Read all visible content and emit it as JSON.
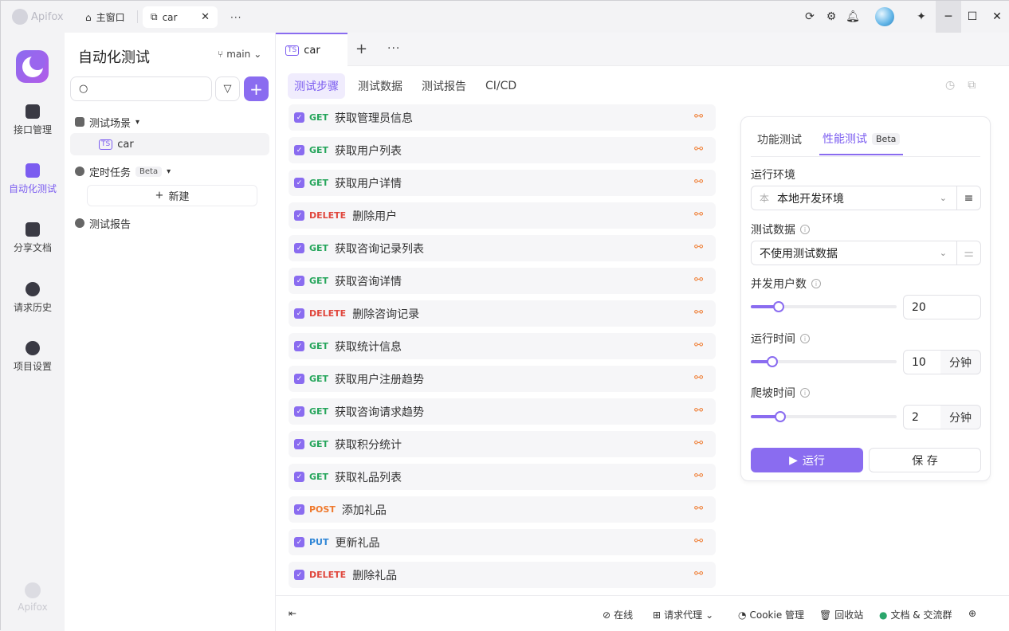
{
  "titlebar": {
    "logo_text": "Apifox",
    "home_tab": "主窗口",
    "doc_tab": "car",
    "more": "···"
  },
  "rail": {
    "items": [
      {
        "label": "接口管理",
        "icon": "api-icon"
      },
      {
        "label": "自动化测试",
        "icon": "automation-icon"
      },
      {
        "label": "分享文档",
        "icon": "book-icon"
      },
      {
        "label": "请求历史",
        "icon": "history-icon"
      },
      {
        "label": "项目设置",
        "icon": "settings-icon"
      }
    ],
    "bottom_text": "Apifox"
  },
  "sidebar": {
    "title": "自动化测试",
    "branch": "main",
    "search_placeholder": "",
    "tree": [
      {
        "label": "测试场景",
        "arrow": "▾"
      },
      {
        "label": "car"
      },
      {
        "label": "定时任务",
        "badge": "Beta",
        "arrow": "▾"
      },
      {
        "label": "测试报告"
      }
    ],
    "new_label": "新建"
  },
  "main": {
    "doc_tab": "car",
    "subtabs": [
      "测试步骤",
      "测试数据",
      "测试报告",
      "CI/CD"
    ],
    "steps": [
      {
        "method": "GET",
        "name": "获取管理员信息"
      },
      {
        "method": "GET",
        "name": "获取用户列表"
      },
      {
        "method": "GET",
        "name": "获取用户详情"
      },
      {
        "method": "DELETE",
        "name": "删除用户"
      },
      {
        "method": "GET",
        "name": "获取咨询记录列表"
      },
      {
        "method": "GET",
        "name": "获取咨询详情"
      },
      {
        "method": "DELETE",
        "name": "删除咨询记录"
      },
      {
        "method": "GET",
        "name": "获取统计信息"
      },
      {
        "method": "GET",
        "name": "获取用户注册趋势"
      },
      {
        "method": "GET",
        "name": "获取咨询请求趋势"
      },
      {
        "method": "GET",
        "name": "获取积分统计"
      },
      {
        "method": "GET",
        "name": "获取礼品列表"
      },
      {
        "method": "POST",
        "name": "添加礼品"
      },
      {
        "method": "PUT",
        "name": "更新礼品"
      },
      {
        "method": "DELETE",
        "name": "删除礼品"
      }
    ]
  },
  "panel": {
    "tabs": [
      "功能测试",
      "性能测试"
    ],
    "beta": "Beta",
    "env_label": "运行环境",
    "env_badge": "本",
    "env_value": "本地开发环境",
    "data_label": "测试数据",
    "data_value": "不使用测试数据",
    "users_label": "并发用户数",
    "users_value": "20",
    "users_fraction": 0.19,
    "time_label": "运行时间",
    "time_value": "10",
    "time_fraction": 0.15,
    "ramp_label": "爬坡时间",
    "ramp_value": "2",
    "ramp_fraction": 0.2,
    "unit": "分钟",
    "run_label": "运行",
    "save_label": "保 存"
  },
  "footer": {
    "online": "在线",
    "proxy": "请求代理",
    "cookie": "Cookie 管理",
    "recycle": "回收站",
    "community": "文档 & 交流群"
  },
  "colors": {
    "accent": "#8a6cf0",
    "get": "#25a55b",
    "delete": "#e0463c",
    "post": "#ef7a2e",
    "put": "#2f86d6"
  }
}
